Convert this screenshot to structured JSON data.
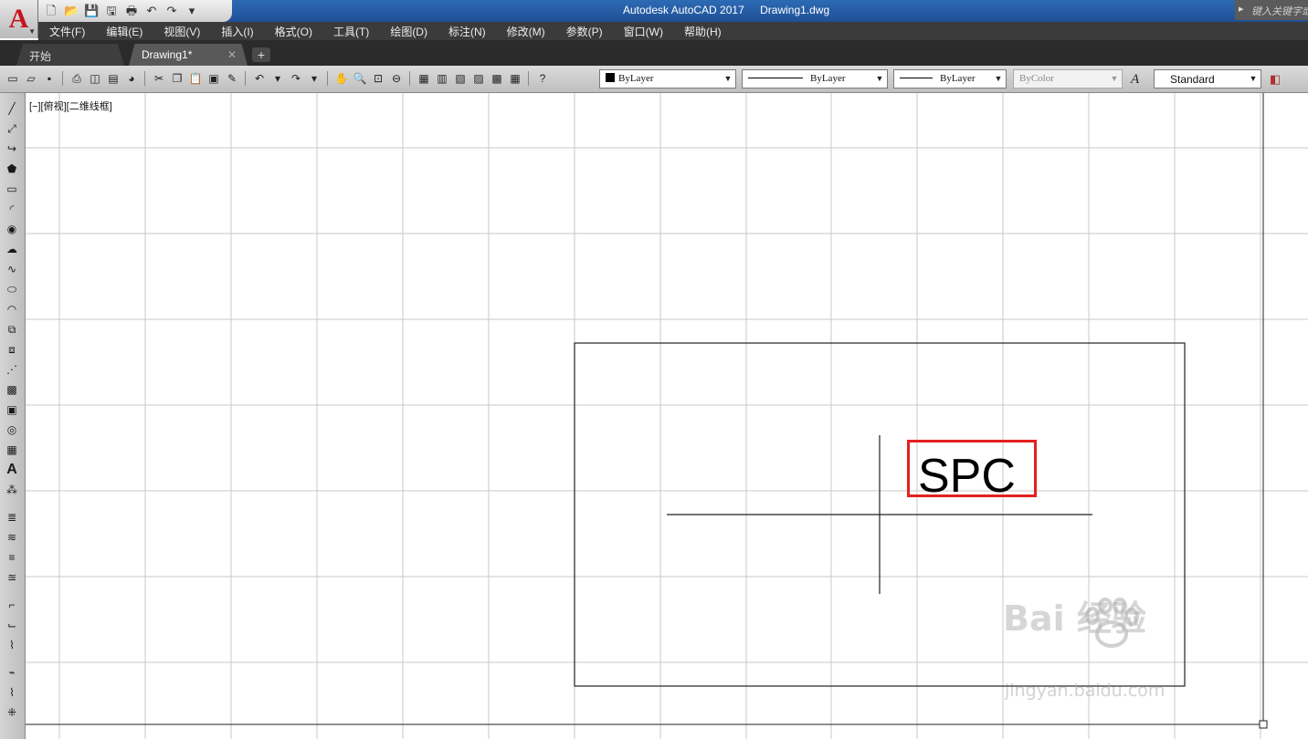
{
  "app": {
    "logo_letter": "A",
    "window_title": "Autodesk AutoCAD 2017",
    "file_name": "Drawing1.dwg",
    "search_placeholder": "键入关键字或"
  },
  "menu": [
    "文件(F)",
    "编辑(E)",
    "视图(V)",
    "插入(I)",
    "格式(O)",
    "工具(T)",
    "绘图(D)",
    "标注(N)",
    "修改(M)",
    "参数(P)",
    "窗口(W)",
    "帮助(H)"
  ],
  "tabs": {
    "start": "开始",
    "drawing": "Drawing1*",
    "close_glyph": "✕",
    "add_glyph": "+"
  },
  "toolbar": {
    "color": "ByLayer",
    "linetype": "ByLayer",
    "lineweight": "ByLayer",
    "plotstyle": "ByColor",
    "textstyle": "Standard"
  },
  "canvas": {
    "viewport_label": "[−][俯视][二维线框]",
    "text_object": "SPC",
    "highlight_color": "#e32020"
  },
  "watermark": {
    "main": "Bai 经验",
    "sub": "jingyan.baidu.com"
  }
}
